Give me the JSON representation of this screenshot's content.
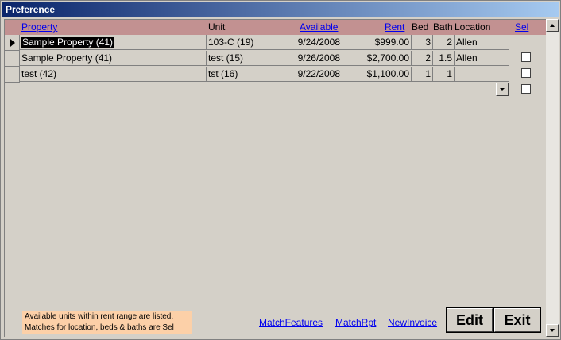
{
  "window": {
    "title": "Preference"
  },
  "table": {
    "headers": {
      "property": "Property",
      "unit": "Unit",
      "available": "Available",
      "rent": "Rent",
      "bed": "Bed",
      "bath": "Bath",
      "location": "Location",
      "sel": "Sel"
    },
    "rows": [
      {
        "property": "Sample Property (41)",
        "unit": "103-C (19)",
        "available": "9/24/2008",
        "rent": "$999.00",
        "bed": "3",
        "bath": "2",
        "location": "Allen",
        "sel": false
      },
      {
        "property": "Sample Property (41)",
        "unit": "test (15)",
        "available": "9/26/2008",
        "rent": "$2,700.00",
        "bed": "2",
        "bath": "1.5",
        "location": "Allen",
        "sel": false
      },
      {
        "property": "test (42)",
        "unit": "tst (16)",
        "available": "9/22/2008",
        "rent": "$1,100.00",
        "bed": "1",
        "bath": "1",
        "location": "",
        "sel": false
      }
    ]
  },
  "footer": {
    "note_line1": "Available units within rent range are listed.",
    "note_line2": "Matches for location, beds & baths are Sel",
    "links": {
      "match_features": "MatchFeatures",
      "match_rpt": "MatchRpt",
      "new_invoice": "NewInvoice"
    },
    "edit_label": "Edit",
    "exit_label": "Exit"
  },
  "colors": {
    "title_bar": "#0a246a",
    "header_band": "#c29191",
    "note_background": "#fcd0a8",
    "link": "#0000ee"
  }
}
